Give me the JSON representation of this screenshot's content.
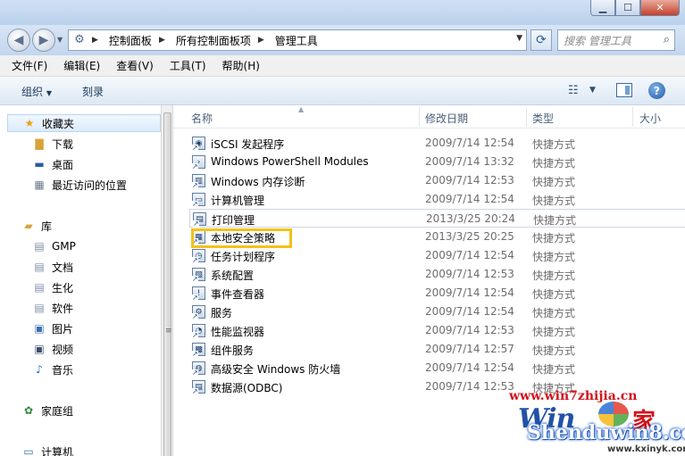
{
  "address": {
    "crumbs": [
      "控制面板",
      "所有控制面板项",
      "管理工具"
    ],
    "search_placeholder": "搜索 管理工具"
  },
  "menu": [
    "文件(F)",
    "编辑(E)",
    "查看(V)",
    "工具(T)",
    "帮助(H)"
  ],
  "toolbar": {
    "organize": "组织",
    "burn": "刻录"
  },
  "nav": {
    "favorites": "收藏夹",
    "downloads": "下载",
    "desktop": "桌面",
    "recent": "最近访问的位置",
    "libraries": "库",
    "lib_items": [
      "GMP",
      "文档",
      "生化",
      "软件",
      "图片",
      "视频",
      "音乐"
    ],
    "homegroup": "家庭组",
    "computer": "计算机"
  },
  "columns": {
    "name": "名称",
    "modified": "修改日期",
    "type": "类型",
    "size": "大小"
  },
  "files": [
    {
      "name": "iSCSI 发起程序",
      "date": "2009/7/14 12:54",
      "type": "快捷方式"
    },
    {
      "name": "Windows PowerShell Modules",
      "date": "2009/7/14 13:32",
      "type": "快捷方式"
    },
    {
      "name": "Windows 内存诊断",
      "date": "2009/7/14 12:53",
      "type": "快捷方式"
    },
    {
      "name": "计算机管理",
      "date": "2009/7/14 12:54",
      "type": "快捷方式"
    },
    {
      "name": "打印管理",
      "date": "2013/3/25 20:24",
      "type": "快捷方式"
    },
    {
      "name": "本地安全策略",
      "date": "2013/3/25 20:25",
      "type": "快捷方式"
    },
    {
      "name": "任务计划程序",
      "date": "2009/7/14 12:54",
      "type": "快捷方式"
    },
    {
      "name": "系统配置",
      "date": "2009/7/14 12:53",
      "type": "快捷方式"
    },
    {
      "name": "事件查看器",
      "date": "2009/7/14 12:54",
      "type": "快捷方式"
    },
    {
      "name": "服务",
      "date": "2009/7/14 12:54",
      "type": "快捷方式"
    },
    {
      "name": "性能监视器",
      "date": "2009/7/14 12:53",
      "type": "快捷方式"
    },
    {
      "name": "组件服务",
      "date": "2009/7/14 12:57",
      "type": "快捷方式"
    },
    {
      "name": "高级安全 Windows 防火墙",
      "date": "2009/7/14 12:54",
      "type": "快捷方式"
    },
    {
      "name": "数据源(ODBC)",
      "date": "2009/7/14 12:53",
      "type": "快捷方式"
    }
  ],
  "watermark": {
    "url": "www.win7zhijia.cn",
    "brand": "Win",
    "jia": "家",
    "shenduwin": "Shenduwin8.com",
    "small": "www.kxinyk.com"
  }
}
